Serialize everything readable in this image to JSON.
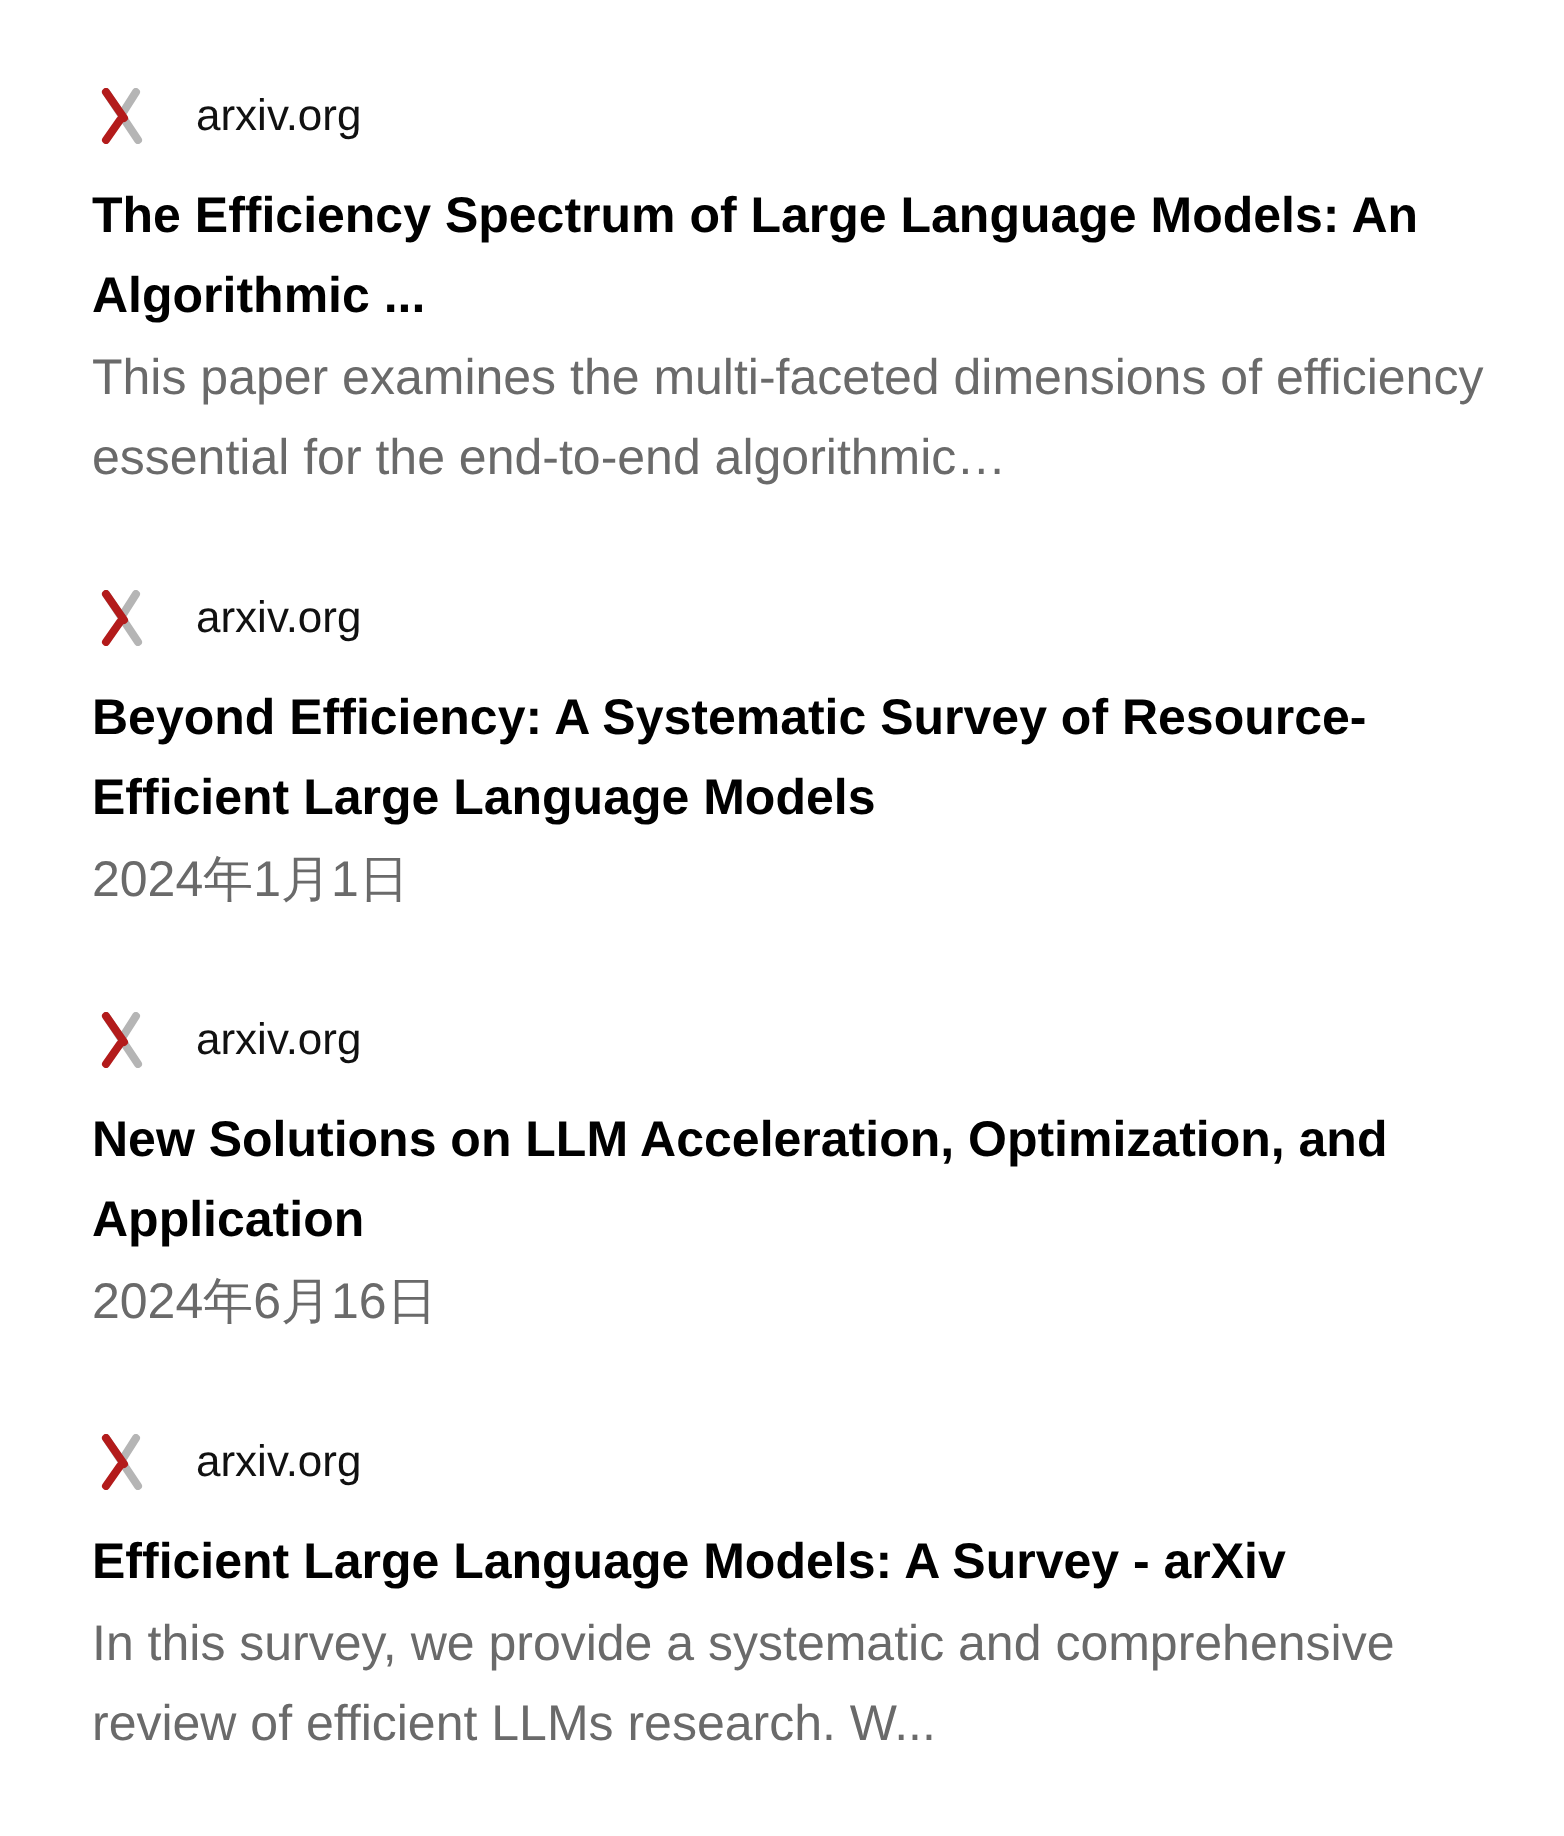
{
  "results": [
    {
      "source": "arxiv.org",
      "title": "The Efficiency Spectrum of Large Language Models: An Algorithmic ...",
      "subtitle": "This paper examines the multi-faceted dimensions of efficiency essential for the end-to-end algorithmic…"
    },
    {
      "source": "arxiv.org",
      "title": "Beyond Efficiency: A Systematic Survey of Resource-Efficient Large Language Models",
      "subtitle": "2024年1月1日"
    },
    {
      "source": "arxiv.org",
      "title": "New Solutions on LLM Acceleration, Optimization, and Application",
      "subtitle": "2024年6月16日"
    },
    {
      "source": "arxiv.org",
      "title": "Efficient Large Language Models: A Survey - arXiv",
      "subtitle": "In this survey, we provide a systematic and comprehensive review of efficient LLMs research. W..."
    }
  ]
}
